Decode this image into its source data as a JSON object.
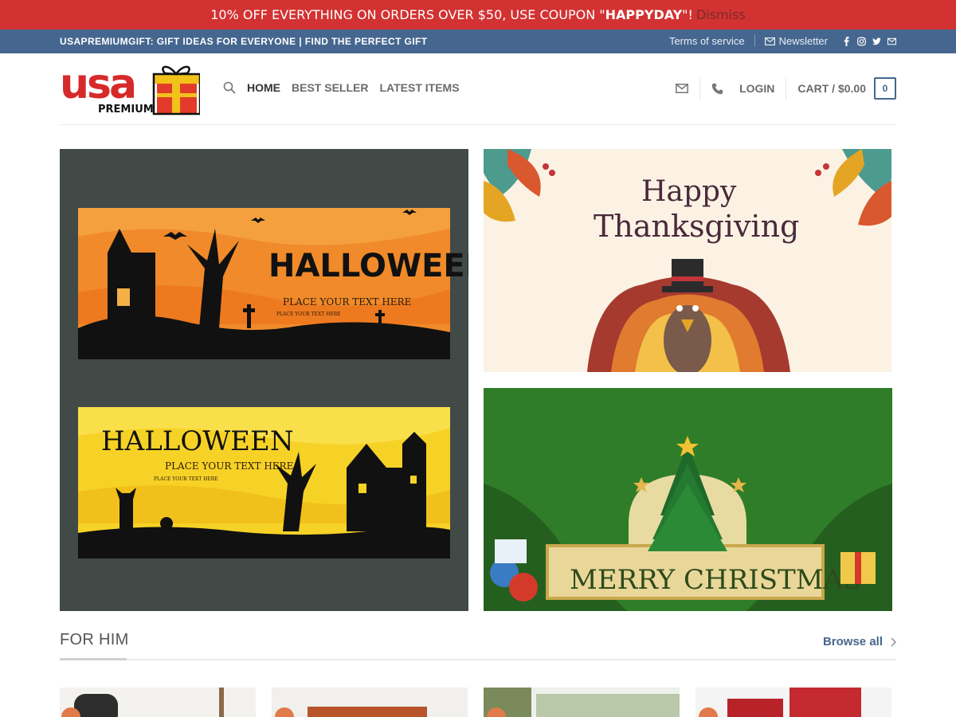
{
  "promo": {
    "text_before": "10% OFF EVERYTHING ON ORDERS OVER $50, USE COUPON \"",
    "coupon": "HAPPYDAY",
    "text_after": "\"!",
    "dismiss": "Dismiss"
  },
  "topbar": {
    "tagline": "USAPREMIUMGIFT: GIFT IDEAS FOR EVERYONE | FIND THE PERFECT GIFT",
    "terms": "Terms of service",
    "newsletter": "Newsletter",
    "social_icons": [
      "facebook-icon",
      "instagram-icon",
      "twitter-icon",
      "email-icon"
    ]
  },
  "header": {
    "logo_text": "usa",
    "logo_sub": "PREMIUM",
    "nav": [
      "HOME",
      "BEST SELLER",
      "LATEST ITEMS"
    ],
    "login": "LOGIN",
    "cart": "CART / $0.00",
    "cart_count": "0"
  },
  "banners": {
    "halloween_top": {
      "title": "HALLOWEEN",
      "line1": "PLACE YOUR TEXT HERE",
      "line2": "PLACE YOUR TEXT HERE"
    },
    "halloween_bottom": {
      "title": "HALLOWEEN",
      "line1": "PLACE YOUR TEXT HERE",
      "line2": "PLACE YOUR TEXT HERE"
    },
    "thanksgiving": {
      "line1": "Happy",
      "line2": "Thanksgiving"
    },
    "christmas": {
      "text": "MERRY CHRISTMAS"
    }
  },
  "section": {
    "title": "FOR HIM",
    "browse": "Browse all"
  },
  "colors": {
    "promo": "#d33232",
    "topbar": "#45668e",
    "accent": "#45668e"
  }
}
